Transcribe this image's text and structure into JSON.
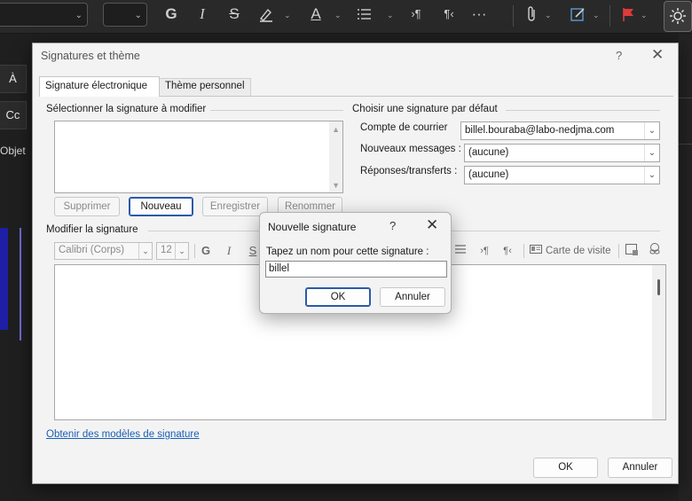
{
  "ribbon": {
    "icons": [
      "bold-icon",
      "italic-icon",
      "strikethrough-icon",
      "highlight-icon",
      "font-color-icon",
      "list-icon",
      "ltr-icon",
      "rtl-icon",
      "more-icon",
      "attach-icon",
      "signature-icon",
      "flag-icon",
      "settings-icon"
    ],
    "bold_glyph": "G",
    "italic_glyph": "I",
    "strike_glyph": "S",
    "font_color_glyph": "A"
  },
  "compose": {
    "to_button": "À",
    "cc_button": "Cc",
    "subject_label": "Objet"
  },
  "dialog": {
    "title": "Signatures et thème",
    "help": "?",
    "close": "✕",
    "tabs": [
      {
        "label": "Signature électronique",
        "active": true
      },
      {
        "label": "Thème personnel",
        "active": false
      }
    ],
    "select_group_label": "Sélectionner la signature à modifier",
    "buttons": {
      "delete": "Supprimer",
      "new": "Nouveau",
      "save": "Enregistrer",
      "rename": "Renommer"
    },
    "default_group_label": "Choisir une signature par défaut",
    "account_label": "Compte de courrier",
    "account_value": "billel.bouraba@labo-nedjma.com",
    "new_messages_label": "Nouveaux messages :",
    "new_messages_value": "(aucune)",
    "replies_label": "Réponses/transferts :",
    "replies_value": "(aucune)",
    "edit_group_label": "Modifier la signature",
    "editor": {
      "font": "Calibri (Corps)",
      "size": "12",
      "bold": "G",
      "italic": "I",
      "underline": "S",
      "business_card": "Carte de visite"
    },
    "templates_link": "Obtenir des modèles de signature",
    "ok": "OK",
    "cancel": "Annuler"
  },
  "new_signature": {
    "title": "Nouvelle signature",
    "help": "?",
    "close": "✕",
    "prompt": "Tapez un nom pour cette signature :",
    "value": "billel",
    "ok": "OK",
    "cancel": "Annuler"
  }
}
